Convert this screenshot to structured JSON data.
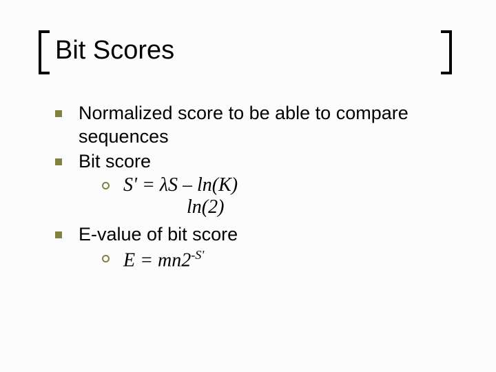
{
  "title": "Bit Scores",
  "bullets": {
    "b1": "Normalized score to be able to compare sequences",
    "b2": "Bit score",
    "b2_formula_line1": "S' = λS – ln(K)",
    "b2_formula_line2": "ln(2)",
    "b3": "E-value of bit score",
    "b3_formula_prefix": "E = mn2",
    "b3_formula_exp": "-S'"
  }
}
